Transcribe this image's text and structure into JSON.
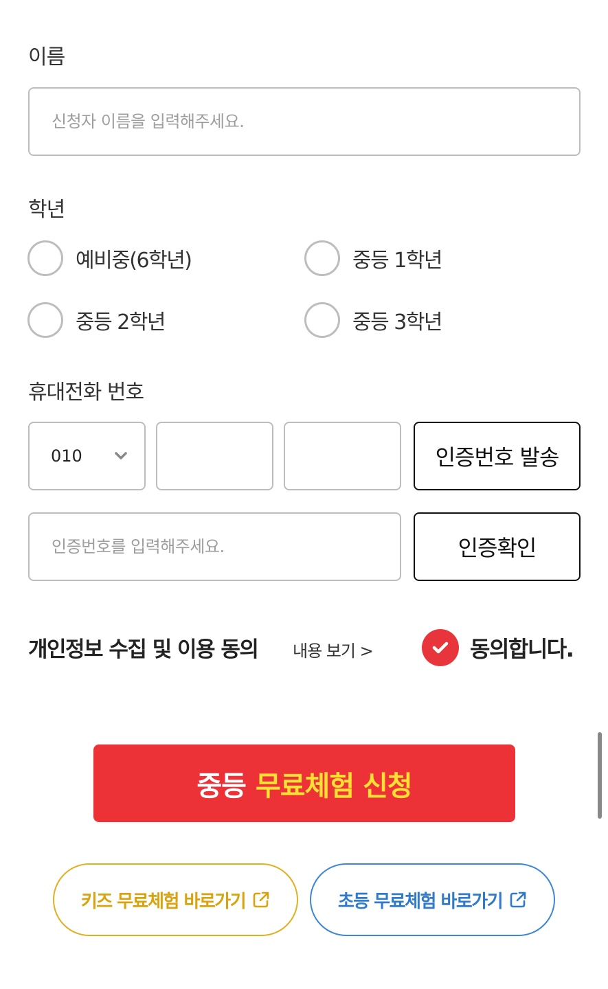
{
  "name_section": {
    "label": "이름",
    "placeholder": "신청자 이름을 입력해주세요."
  },
  "grade_section": {
    "label": "학년",
    "options": [
      "예비중(6학년)",
      "중등 1학년",
      "중등 2학년",
      "중등 3학년"
    ]
  },
  "phone_section": {
    "label": "휴대전화 번호",
    "prefix_value": "010",
    "send_code_button": "인증번호 발송",
    "code_placeholder": "인증번호를 입력해주세요.",
    "verify_button": "인증확인"
  },
  "consent": {
    "title": "개인정보 수집 및 이용 동의",
    "view_link": "내용 보기 >",
    "agree_label": "동의합니다.",
    "checked": true
  },
  "submit": {
    "label_white": "중등",
    "label_yellow": "무료체험 신청"
  },
  "links": {
    "kids": "키즈 무료체험 바로가기",
    "elementary": "초등 무료체험 바로가기"
  },
  "colors": {
    "accent_red": "#ec3237",
    "yellow": "#ffe033",
    "kids_gold": "#e0b021",
    "elementary_blue": "#3d86d1"
  }
}
